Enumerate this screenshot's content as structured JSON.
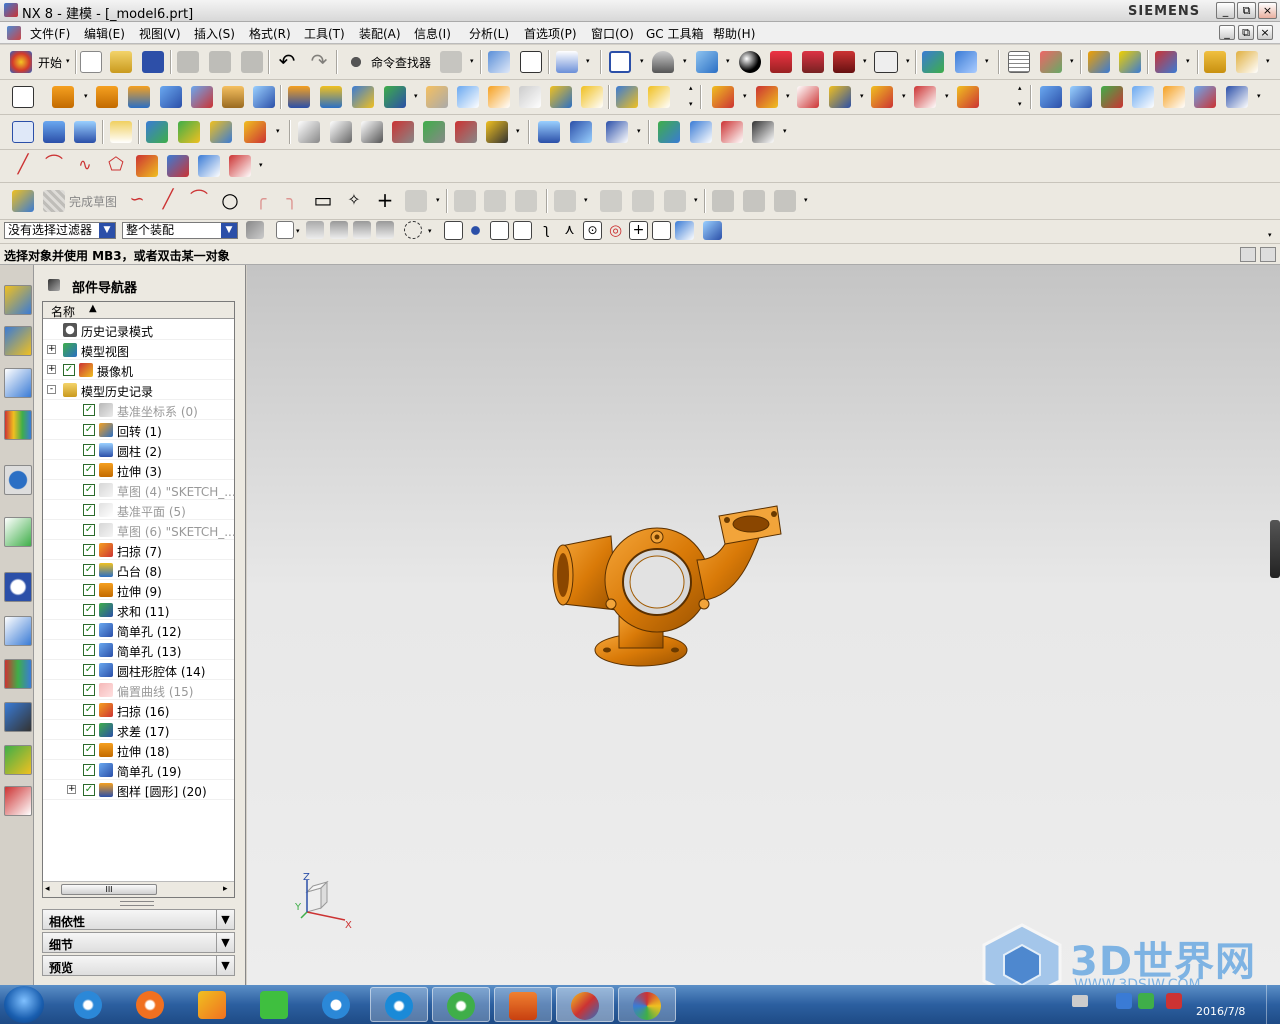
{
  "window": {
    "title": "NX 8 - 建模 - [_model6.prt]",
    "brand": "SIEMENS",
    "controls": {
      "minimize": "_",
      "restore": "⧉",
      "close": "×"
    }
  },
  "menubar": {
    "items": [
      "文件(F)",
      "编辑(E)",
      "视图(V)",
      "插入(S)",
      "格式(R)",
      "工具(T)",
      "装配(A)",
      "信息(I)",
      "分析(L)",
      "首选项(P)",
      "窗口(O)",
      "GC 工具箱",
      "帮助(H)"
    ]
  },
  "toolbar": {
    "start_label": "开始",
    "command_finder_label": "命令查找器",
    "finish_sketch_label": "完成草图"
  },
  "selection_bar": {
    "type_filter": "没有选择过滤器",
    "scope": "整个装配"
  },
  "cue_line": "选择对象并使用 MB3，或者双击某一对象",
  "part_navigator": {
    "title": "部件导航器",
    "column_header": "名称",
    "nodes": [
      {
        "label": "历史记录模式",
        "icon": "clock-icon",
        "level": 0,
        "expander": "",
        "checked": false,
        "dim": false
      },
      {
        "label": "模型视图",
        "icon": "model-views-icon",
        "level": 0,
        "expander": "+",
        "checked": false,
        "dim": false
      },
      {
        "label": "摄像机",
        "icon": "camera-icon",
        "level": 0,
        "expander": "+",
        "checked": true,
        "dim": false
      },
      {
        "label": "模型历史记录",
        "icon": "folder-icon",
        "level": 0,
        "expander": "−",
        "checked": false,
        "dim": false
      },
      {
        "label": "基准坐标系 (0)",
        "icon": "datum-csys-icon",
        "level": 1,
        "checked": true,
        "dim": true
      },
      {
        "label": "回转 (1)",
        "icon": "revolve-icon",
        "level": 1,
        "checked": true,
        "dim": false
      },
      {
        "label": "圆柱 (2)",
        "icon": "cylinder-icon",
        "level": 1,
        "checked": true,
        "dim": false
      },
      {
        "label": "拉伸 (3)",
        "icon": "extrude-icon",
        "level": 1,
        "checked": true,
        "dim": false
      },
      {
        "label": "草图 (4) \"SKETCH_...",
        "icon": "sketch-icon",
        "level": 1,
        "checked": true,
        "dim": true
      },
      {
        "label": "基准平面 (5)",
        "icon": "datum-plane-icon",
        "level": 1,
        "checked": true,
        "dim": true
      },
      {
        "label": "草图 (6) \"SKETCH_...",
        "icon": "sketch-icon",
        "level": 1,
        "checked": true,
        "dim": true
      },
      {
        "label": "扫掠 (7)",
        "icon": "swept-icon",
        "level": 1,
        "checked": true,
        "dim": false
      },
      {
        "label": "凸台 (8)",
        "icon": "boss-icon",
        "level": 1,
        "checked": true,
        "dim": false
      },
      {
        "label": "拉伸 (9)",
        "icon": "extrude-icon",
        "level": 1,
        "checked": true,
        "dim": false
      },
      {
        "label": "求和 (11)",
        "icon": "unite-icon",
        "level": 1,
        "checked": true,
        "dim": false
      },
      {
        "label": "简单孔 (12)",
        "icon": "hole-icon",
        "level": 1,
        "checked": true,
        "dim": false
      },
      {
        "label": "简单孔 (13)",
        "icon": "hole-icon",
        "level": 1,
        "checked": true,
        "dim": false
      },
      {
        "label": "圆柱形腔体 (14)",
        "icon": "pocket-icon",
        "level": 1,
        "checked": true,
        "dim": false
      },
      {
        "label": "偏置曲线 (15)",
        "icon": "offset-curve-icon",
        "level": 1,
        "checked": true,
        "dim": true
      },
      {
        "label": "扫掠 (16)",
        "icon": "swept-icon",
        "level": 1,
        "checked": true,
        "dim": false
      },
      {
        "label": "求差 (17)",
        "icon": "subtract-icon",
        "level": 1,
        "checked": true,
        "dim": false
      },
      {
        "label": "拉伸 (18)",
        "icon": "extrude-icon",
        "level": 1,
        "checked": true,
        "dim": false
      },
      {
        "label": "简单孔 (19)",
        "icon": "hole-icon",
        "level": 1,
        "checked": true,
        "dim": false
      },
      {
        "label": "图样 [圆形] (20)",
        "icon": "pattern-icon",
        "level": 1,
        "expander": "+",
        "checked": true,
        "dim": false
      }
    ],
    "panels": [
      "相依性",
      "细节",
      "预览"
    ]
  },
  "viewport": {
    "triad_labels": {
      "x": "X",
      "y": "Y",
      "z": "Z"
    },
    "model_color": "#d97a08"
  },
  "watermark": {
    "text": "3D世界网",
    "url": "WWW.3DSJW.COM"
  },
  "taskbar": {
    "date": "2016/7/8",
    "apps": [
      "ie-icon",
      "browser-icon",
      "kugou-icon",
      "iqiyi-icon",
      "k-icon",
      "app-icon",
      "refresh-icon",
      "pdf-icon",
      "nx-icon",
      "paint-icon"
    ]
  },
  "colors": {
    "accent": "#2b4fa8",
    "model": "#d97a08",
    "check": "#1a8a1a"
  }
}
